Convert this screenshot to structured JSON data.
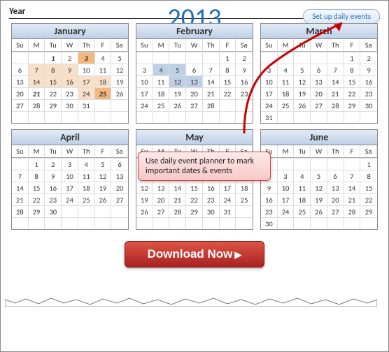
{
  "header": {
    "year_label": "Year",
    "year_value": "2013",
    "setup_btn": "Set up daily events"
  },
  "dows": [
    "Su",
    "M",
    "Tu",
    "W",
    "Th",
    "F",
    "Sa"
  ],
  "months": [
    {
      "name": "January",
      "start": 2,
      "days": 31,
      "hl": {
        "1": "bold",
        "3": "hlstrong",
        "7": "hl",
        "8": "hl",
        "9": "hl",
        "14": "hl",
        "15": "hl",
        "16": "hl",
        "17": "hl",
        "18": "hl",
        "21": "bold",
        "24": "hl",
        "25": "hlstrong"
      }
    },
    {
      "name": "February",
      "start": 5,
      "days": 28,
      "hl": {
        "4": "hl2",
        "5": "hl2",
        "12": "hl2",
        "13": "hl2"
      }
    },
    {
      "name": "March",
      "start": 5,
      "days": 31,
      "hl": {}
    },
    {
      "name": "April",
      "start": 1,
      "days": 30,
      "hl": {}
    },
    {
      "name": "May",
      "start": 3,
      "days": 31,
      "hl": {}
    },
    {
      "name": "June",
      "start": 6,
      "days": 30,
      "hl": {}
    }
  ],
  "callout": "Use daily event planner to mark important dates & events",
  "download": "Download Now"
}
